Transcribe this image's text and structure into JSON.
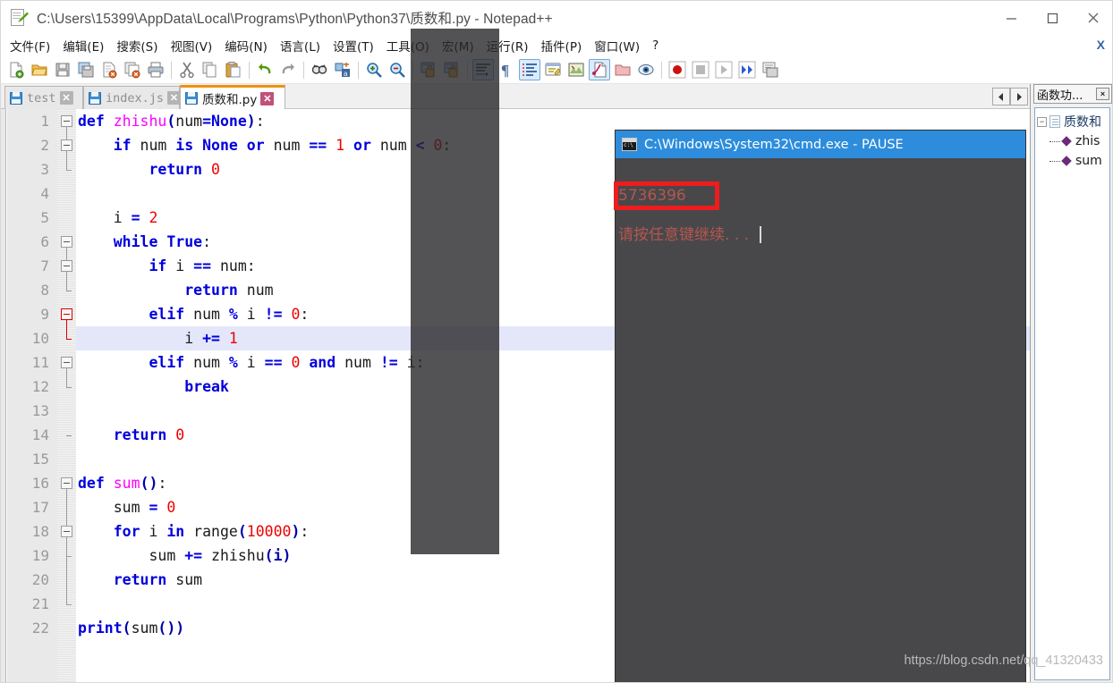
{
  "window": {
    "title": "C:\\Users\\15399\\AppData\\Local\\Programs\\Python\\Python37\\质数和.py - Notepad++",
    "icon": "notepad-plus-plus-icon",
    "minimize_label": "—",
    "maximize_label": "□",
    "close_label": "✕"
  },
  "menu": {
    "items": [
      {
        "label": "文件(F)",
        "name": "menu-file"
      },
      {
        "label": "编辑(E)",
        "name": "menu-edit"
      },
      {
        "label": "搜索(S)",
        "name": "menu-search"
      },
      {
        "label": "视图(V)",
        "name": "menu-view"
      },
      {
        "label": "编码(N)",
        "name": "menu-encoding"
      },
      {
        "label": "语言(L)",
        "name": "menu-language"
      },
      {
        "label": "设置(T)",
        "name": "menu-settings"
      },
      {
        "label": "工具(O)",
        "name": "menu-tools"
      },
      {
        "label": "宏(M)",
        "name": "menu-macro"
      },
      {
        "label": "运行(R)",
        "name": "menu-run"
      },
      {
        "label": "插件(P)",
        "name": "menu-plugins"
      },
      {
        "label": "窗口(W)",
        "name": "menu-window"
      },
      {
        "label": "?",
        "name": "menu-help"
      }
    ],
    "close_document_label": "X"
  },
  "toolbar": {
    "buttons": [
      {
        "name": "new-file-icon",
        "title": "新建"
      },
      {
        "name": "open-file-icon",
        "title": "打开"
      },
      {
        "name": "save-icon",
        "title": "保存"
      },
      {
        "name": "save-all-icon",
        "title": "全部保存"
      },
      {
        "name": "close-file-icon",
        "title": "关闭"
      },
      {
        "name": "close-all-icon",
        "title": "全部关闭"
      },
      {
        "name": "print-icon",
        "title": "打印"
      },
      {
        "name": "cut-icon",
        "title": "剪切"
      },
      {
        "name": "copy-icon",
        "title": "复制"
      },
      {
        "name": "paste-icon",
        "title": "粘贴"
      },
      {
        "name": "undo-icon",
        "title": "撤销"
      },
      {
        "name": "redo-icon",
        "title": "重做"
      },
      {
        "name": "find-icon",
        "title": "查找"
      },
      {
        "name": "replace-icon",
        "title": "替换"
      },
      {
        "name": "zoom-in-icon",
        "title": "放大"
      },
      {
        "name": "zoom-out-icon",
        "title": "缩小"
      },
      {
        "name": "sync-vertical-icon",
        "title": "垂直同步滚动"
      },
      {
        "name": "sync-horizontal-icon",
        "title": "水平同步滚动"
      },
      {
        "name": "word-wrap-icon",
        "title": "自动换行",
        "active": true
      },
      {
        "name": "show-all-chars-icon",
        "title": "显示所有字符"
      },
      {
        "name": "indent-guide-icon",
        "title": "缩进参考线",
        "active": true
      },
      {
        "name": "user-language-icon",
        "title": "用户自定义语言"
      },
      {
        "name": "document-map-icon",
        "title": "文档地图"
      },
      {
        "name": "function-list-icon",
        "title": "函数列表",
        "active": true
      },
      {
        "name": "folder-workspace-icon",
        "title": "文件夹作为工作区"
      },
      {
        "name": "monitor-icon",
        "title": "监视文件"
      },
      {
        "name": "macro-record-icon",
        "title": "开始录制宏"
      },
      {
        "name": "macro-stop-icon",
        "title": "停止录制宏"
      },
      {
        "name": "macro-play-icon",
        "title": "播放宏"
      },
      {
        "name": "macro-multi-play-icon",
        "title": "多次运行宏"
      },
      {
        "name": "macro-save-icon",
        "title": "保存当前录制的宏"
      }
    ]
  },
  "tabs": {
    "items": [
      {
        "label": "test",
        "active": false,
        "close_label": "✕"
      },
      {
        "label": "index.js",
        "active": false,
        "close_label": "✕"
      },
      {
        "label": "质数和.py",
        "active": true,
        "close_label": "✕"
      }
    ],
    "nav_prev": "◀",
    "nav_next": "▶"
  },
  "function_panel": {
    "title": "函数功...",
    "close_label": "×",
    "tree": {
      "root_label": "质数和",
      "root_toggle": "−",
      "children": [
        {
          "label": "zhis"
        },
        {
          "label": "sum"
        }
      ]
    }
  },
  "editor": {
    "current_line": 10,
    "lines": [
      {
        "n": 1,
        "tokens": [
          {
            "t": "def",
            "c": "kw"
          },
          {
            "t": " ",
            "c": "txt"
          },
          {
            "t": "zhishu",
            "c": "fn"
          },
          {
            "t": "(",
            "c": "pun"
          },
          {
            "t": "num",
            "c": "txt"
          },
          {
            "t": "=",
            "c": "op"
          },
          {
            "t": "None",
            "c": "kw"
          },
          {
            "t": ")",
            "c": "pun"
          },
          {
            "t": ":",
            "c": "txt"
          }
        ]
      },
      {
        "n": 2,
        "tokens": [
          {
            "t": "    ",
            "c": "txt"
          },
          {
            "t": "if",
            "c": "kw"
          },
          {
            "t": " num ",
            "c": "txt"
          },
          {
            "t": "is",
            "c": "kw"
          },
          {
            "t": " ",
            "c": "txt"
          },
          {
            "t": "None",
            "c": "kw"
          },
          {
            "t": " ",
            "c": "txt"
          },
          {
            "t": "or",
            "c": "kw"
          },
          {
            "t": " num ",
            "c": "txt"
          },
          {
            "t": "==",
            "c": "op"
          },
          {
            "t": " ",
            "c": "txt"
          },
          {
            "t": "1",
            "c": "num"
          },
          {
            "t": " ",
            "c": "txt"
          },
          {
            "t": "or",
            "c": "kw"
          },
          {
            "t": " num ",
            "c": "txt"
          },
          {
            "t": "<",
            "c": "op"
          },
          {
            "t": " ",
            "c": "txt"
          },
          {
            "t": "0",
            "c": "num"
          },
          {
            "t": ":",
            "c": "txt"
          }
        ]
      },
      {
        "n": 3,
        "tokens": [
          {
            "t": "        ",
            "c": "txt"
          },
          {
            "t": "return",
            "c": "kw"
          },
          {
            "t": " ",
            "c": "txt"
          },
          {
            "t": "0",
            "c": "num"
          }
        ]
      },
      {
        "n": 4,
        "tokens": []
      },
      {
        "n": 5,
        "tokens": [
          {
            "t": "    i ",
            "c": "txt"
          },
          {
            "t": "=",
            "c": "op"
          },
          {
            "t": " ",
            "c": "txt"
          },
          {
            "t": "2",
            "c": "num"
          }
        ]
      },
      {
        "n": 6,
        "tokens": [
          {
            "t": "    ",
            "c": "txt"
          },
          {
            "t": "while",
            "c": "kw"
          },
          {
            "t": " ",
            "c": "txt"
          },
          {
            "t": "True",
            "c": "kw"
          },
          {
            "t": ":",
            "c": "txt"
          }
        ]
      },
      {
        "n": 7,
        "tokens": [
          {
            "t": "        ",
            "c": "txt"
          },
          {
            "t": "if",
            "c": "kw"
          },
          {
            "t": " i ",
            "c": "txt"
          },
          {
            "t": "==",
            "c": "op"
          },
          {
            "t": " num:",
            "c": "txt"
          }
        ]
      },
      {
        "n": 8,
        "tokens": [
          {
            "t": "            ",
            "c": "txt"
          },
          {
            "t": "return",
            "c": "kw"
          },
          {
            "t": " num",
            "c": "txt"
          }
        ]
      },
      {
        "n": 9,
        "tokens": [
          {
            "t": "        ",
            "c": "txt"
          },
          {
            "t": "elif",
            "c": "kw"
          },
          {
            "t": " num ",
            "c": "txt"
          },
          {
            "t": "%",
            "c": "op"
          },
          {
            "t": " i ",
            "c": "txt"
          },
          {
            "t": "!=",
            "c": "op"
          },
          {
            "t": " ",
            "c": "txt"
          },
          {
            "t": "0",
            "c": "num"
          },
          {
            "t": ":",
            "c": "txt"
          }
        ]
      },
      {
        "n": 10,
        "tokens": [
          {
            "t": "            i ",
            "c": "txt"
          },
          {
            "t": "+=",
            "c": "op"
          },
          {
            "t": " ",
            "c": "txt"
          },
          {
            "t": "1",
            "c": "num"
          }
        ]
      },
      {
        "n": 11,
        "tokens": [
          {
            "t": "        ",
            "c": "txt"
          },
          {
            "t": "elif",
            "c": "kw"
          },
          {
            "t": " num ",
            "c": "txt"
          },
          {
            "t": "%",
            "c": "op"
          },
          {
            "t": " i ",
            "c": "txt"
          },
          {
            "t": "==",
            "c": "op"
          },
          {
            "t": " ",
            "c": "txt"
          },
          {
            "t": "0",
            "c": "num"
          },
          {
            "t": " ",
            "c": "txt"
          },
          {
            "t": "and",
            "c": "kw"
          },
          {
            "t": " num ",
            "c": "txt"
          },
          {
            "t": "!=",
            "c": "op"
          },
          {
            "t": " i:",
            "c": "txt"
          }
        ]
      },
      {
        "n": 12,
        "tokens": [
          {
            "t": "            ",
            "c": "txt"
          },
          {
            "t": "break",
            "c": "kw"
          }
        ]
      },
      {
        "n": 13,
        "tokens": []
      },
      {
        "n": 14,
        "tokens": [
          {
            "t": "    ",
            "c": "txt"
          },
          {
            "t": "return",
            "c": "kw"
          },
          {
            "t": " ",
            "c": "txt"
          },
          {
            "t": "0",
            "c": "num"
          }
        ]
      },
      {
        "n": 15,
        "tokens": []
      },
      {
        "n": 16,
        "tokens": [
          {
            "t": "def",
            "c": "kw"
          },
          {
            "t": " ",
            "c": "txt"
          },
          {
            "t": "sum",
            "c": "fn"
          },
          {
            "t": "()",
            "c": "pun"
          },
          {
            "t": ":",
            "c": "txt"
          }
        ]
      },
      {
        "n": 17,
        "tokens": [
          {
            "t": "    sum ",
            "c": "txt"
          },
          {
            "t": "=",
            "c": "op"
          },
          {
            "t": " ",
            "c": "txt"
          },
          {
            "t": "0",
            "c": "num"
          }
        ]
      },
      {
        "n": 18,
        "tokens": [
          {
            "t": "    ",
            "c": "txt"
          },
          {
            "t": "for",
            "c": "kw"
          },
          {
            "t": " i ",
            "c": "txt"
          },
          {
            "t": "in",
            "c": "kw"
          },
          {
            "t": " range",
            "c": "txt"
          },
          {
            "t": "(",
            "c": "pun"
          },
          {
            "t": "10000",
            "c": "num"
          },
          {
            "t": ")",
            "c": "pun"
          },
          {
            "t": ":",
            "c": "txt"
          }
        ]
      },
      {
        "n": 19,
        "tokens": [
          {
            "t": "        sum ",
            "c": "txt"
          },
          {
            "t": "+=",
            "c": "op"
          },
          {
            "t": " zhishu",
            "c": "txt"
          },
          {
            "t": "(i)",
            "c": "pun"
          }
        ]
      },
      {
        "n": 20,
        "tokens": [
          {
            "t": "    ",
            "c": "txt"
          },
          {
            "t": "return",
            "c": "kw"
          },
          {
            "t": " sum",
            "c": "txt"
          }
        ]
      },
      {
        "n": 21,
        "tokens": []
      },
      {
        "n": 22,
        "tokens": [
          {
            "t": "print",
            "c": "kw"
          },
          {
            "t": "(",
            "c": "pun"
          },
          {
            "t": "sum",
            "c": "txt"
          },
          {
            "t": "())",
            "c": "pun"
          }
        ]
      }
    ],
    "fold_markers": [
      {
        "line": 1,
        "type": "box"
      },
      {
        "line": 2,
        "type": "box"
      },
      {
        "line": 3,
        "type": "end"
      },
      {
        "line": 6,
        "type": "box"
      },
      {
        "line": 7,
        "type": "box"
      },
      {
        "line": 8,
        "type": "end"
      },
      {
        "line": 9,
        "type": "box-red"
      },
      {
        "line": 10,
        "type": "end-red"
      },
      {
        "line": 11,
        "type": "box"
      },
      {
        "line": 12,
        "type": "end"
      },
      {
        "line": 14,
        "type": "end"
      },
      {
        "line": 16,
        "type": "box"
      },
      {
        "line": 18,
        "type": "box"
      },
      {
        "line": 19,
        "type": "end"
      },
      {
        "line": 21,
        "type": "end"
      }
    ]
  },
  "console": {
    "title": "C:\\Windows\\System32\\cmd.exe - PAUSE",
    "icon": "cmd-icon",
    "output": "5736396",
    "pause_message": "请按任意键继续. . .",
    "highlight_color": "#ee1c1c",
    "text_color": "#b4564e",
    "title_bg": "#2d8ddc",
    "body_bg": "#48484b"
  },
  "watermark": {
    "text": "https://blog.csdn.net/qq_41320433"
  }
}
